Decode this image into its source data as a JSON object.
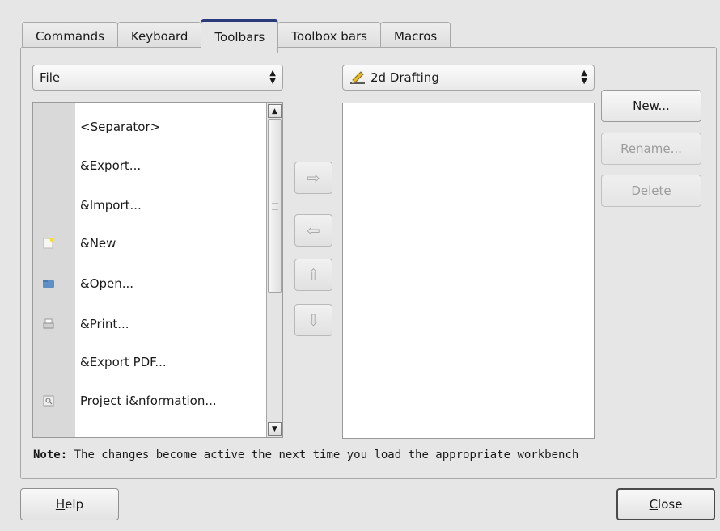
{
  "tabs": [
    {
      "label": "Commands",
      "active": false
    },
    {
      "label": "Keyboard",
      "active": false
    },
    {
      "label": "Toolbars",
      "active": true
    },
    {
      "label": "Toolbox bars",
      "active": false
    },
    {
      "label": "Macros",
      "active": false
    }
  ],
  "category_combo": {
    "value": "File",
    "arrows": "⬍"
  },
  "toolbar_combo": {
    "value": "2d Drafting",
    "icon": "pencil-icon"
  },
  "commands": [
    {
      "label": "<Separator>",
      "icon": ""
    },
    {
      "label": "&Export...",
      "icon": ""
    },
    {
      "label": "&Import...",
      "icon": ""
    },
    {
      "label": "&New",
      "icon": "new-document-icon"
    },
    {
      "label": "&Open...",
      "icon": "folder-icon"
    },
    {
      "label": "&Print...",
      "icon": "printer-icon"
    },
    {
      "label": "&Export PDF...",
      "icon": ""
    },
    {
      "label": "Project i&nformation...",
      "icon": "project-info-icon"
    }
  ],
  "move_buttons": {
    "right": "⇨",
    "left": "⇦",
    "up": "⇧",
    "down": "⇩"
  },
  "side_buttons": {
    "new": "New...",
    "rename": "Rename...",
    "delete": "Delete"
  },
  "note": {
    "bold": "Note:",
    "text": " The changes become active the next time you load the appropriate workbench"
  },
  "help_button": {
    "mnemonic": "H",
    "rest": "elp"
  },
  "close_button": {
    "mnemonic": "C",
    "rest": "lose"
  },
  "colors": {
    "active_tab_accent": "#2b3a7a",
    "window_bg": "#e6e6e6"
  }
}
